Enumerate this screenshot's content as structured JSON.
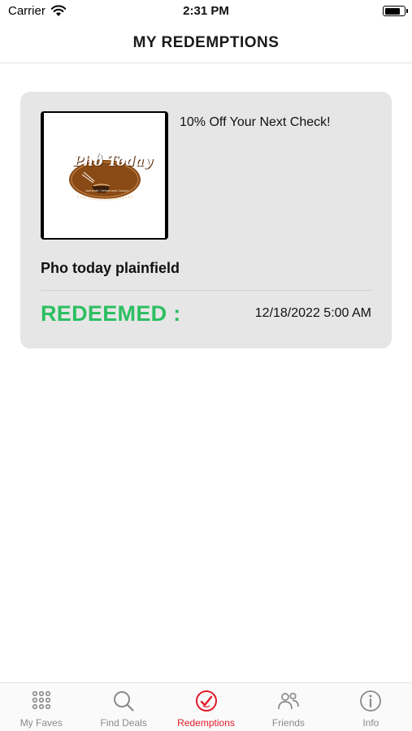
{
  "status_bar": {
    "carrier": "Carrier",
    "time": "2:31 PM",
    "battery_level": 0.7
  },
  "header": {
    "title": "MY REDEMPTIONS"
  },
  "redemptions": [
    {
      "logo": {
        "brand": "Pho Today",
        "tagline": "Authentic Vietnamese Cuisine",
        "icon": "pho-today-logo"
      },
      "deal": "10% Off Your Next Check!",
      "store": "Pho today plainfield",
      "status_label": "REDEEMED :",
      "date": "12/18/2022 5:00 AM"
    }
  ],
  "tab_bar": {
    "active": "Redemptions",
    "tabs": [
      {
        "label": "My Faves",
        "icon": "grid-icon"
      },
      {
        "label": "Find Deals",
        "icon": "search-icon"
      },
      {
        "label": "Redemptions",
        "icon": "redemption-check-icon"
      },
      {
        "label": "Friends",
        "icon": "friends-icon"
      },
      {
        "label": "Info",
        "icon": "info-icon"
      }
    ]
  },
  "colors": {
    "accent": "#e21b2a",
    "redeemed": "#2dbf62",
    "card": "#e6e6e6",
    "logo_brown": "#8a4a16"
  }
}
